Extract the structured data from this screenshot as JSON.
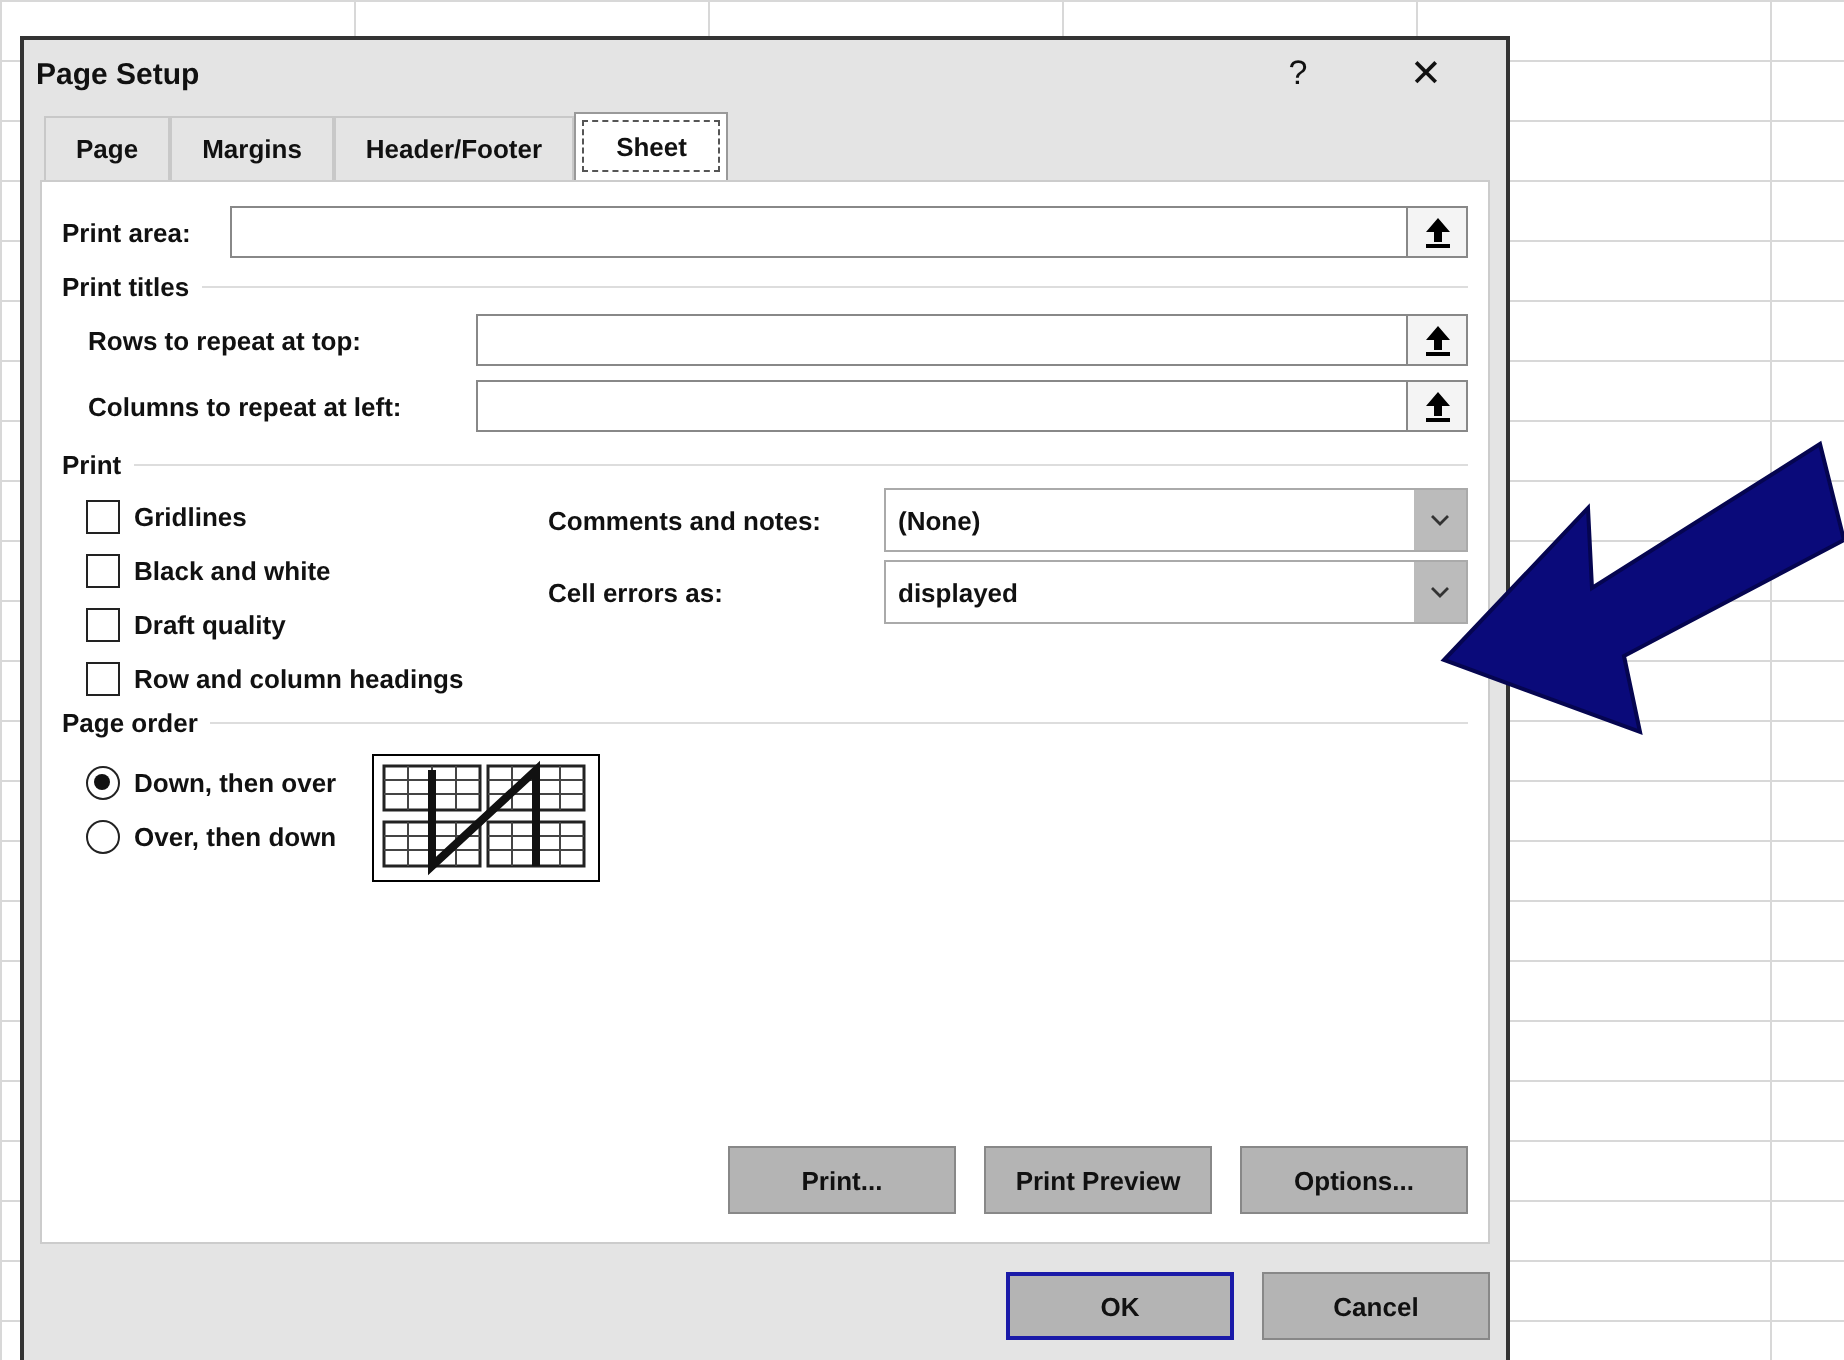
{
  "window": {
    "title": "Page Setup",
    "help": "?",
    "close": "✕"
  },
  "tabs": [
    {
      "label": "Page",
      "selected": false
    },
    {
      "label": "Margins",
      "selected": false
    },
    {
      "label": "Header/Footer",
      "selected": false
    },
    {
      "label": "Sheet",
      "selected": true
    }
  ],
  "print_area": {
    "label": "Print area:"
  },
  "print_titles": {
    "heading": "Print titles",
    "fields": [
      {
        "label": "Rows to repeat at top:"
      },
      {
        "label": "Columns to repeat at left:"
      }
    ]
  },
  "print": {
    "heading": "Print",
    "options": [
      {
        "label": "Gridlines",
        "checked": false
      },
      {
        "label": "Black and white",
        "checked": false
      },
      {
        "label": "Draft quality",
        "checked": false
      },
      {
        "label": "Row and column headings",
        "checked": false
      }
    ],
    "dropdowns": [
      {
        "label": "Comments and notes:",
        "value": "(None)"
      },
      {
        "label": "Cell errors as:",
        "value": "displayed"
      }
    ]
  },
  "page_order": {
    "heading": "Page order",
    "options": [
      {
        "label": "Down, then over",
        "selected": true
      },
      {
        "label": "Over, then down",
        "selected": false
      }
    ]
  },
  "buttons": [
    "Print...",
    "Print Preview",
    "Options..."
  ],
  "footer_buttons": [
    {
      "label": "OK",
      "default": true
    },
    {
      "label": "Cancel",
      "default": false
    }
  ]
}
